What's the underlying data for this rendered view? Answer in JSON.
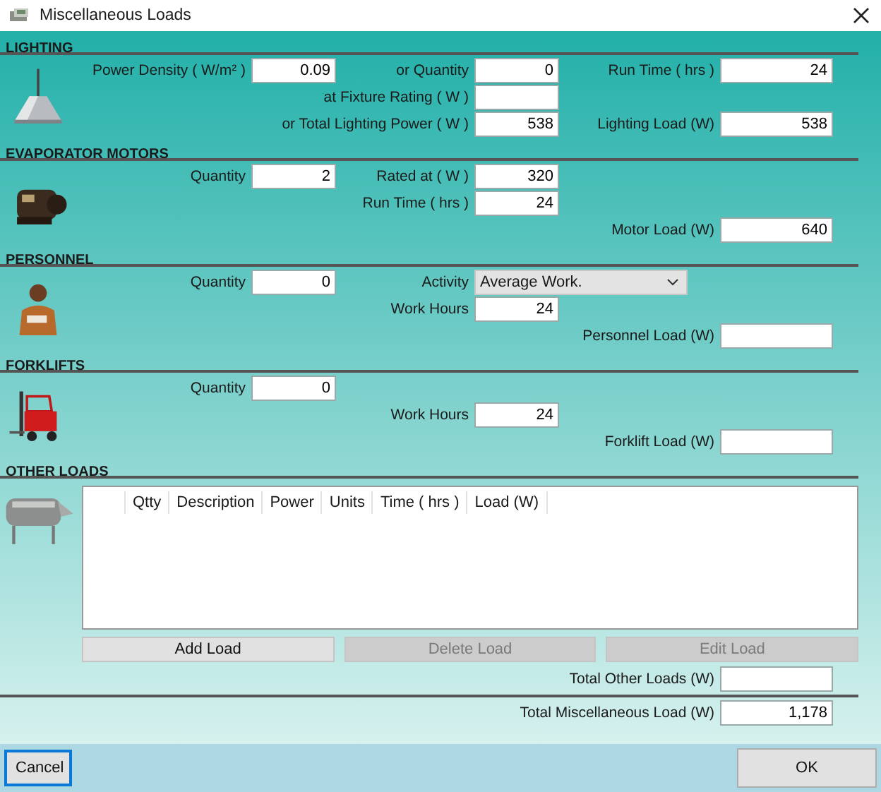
{
  "window": {
    "title": "Miscellaneous Loads"
  },
  "sections": [
    {
      "title": "LIGHTING",
      "rows": [
        {
          "left": {
            "label": "Power Density ( W/m² )",
            "value": "0.09"
          },
          "middle": {
            "label": "or Quantity",
            "value": "0"
          },
          "right": {
            "label": "Run Time ( hrs )",
            "value": "24"
          }
        },
        {
          "middle": {
            "label": "at Fixture Rating ( W )"
          }
        },
        {
          "middle": {
            "label": "or Total Lighting Power ( W )",
            "value": "538"
          },
          "right": {
            "label": "Lighting Load (W)",
            "value": "538"
          }
        }
      ]
    },
    {
      "title": "EVAPORATOR MOTORS",
      "rows": [
        {
          "left": {
            "label": "Quantity",
            "value": "2"
          },
          "middle": {
            "label": "Rated at ( W )",
            "value": "320"
          }
        },
        {
          "middle": {
            "label": "Run Time ( hrs )",
            "value": "24"
          }
        },
        {
          "right": {
            "label": "Motor Load (W)",
            "value": "640"
          }
        }
      ]
    },
    {
      "title": "PERSONNEL",
      "rows": [
        {
          "left": {
            "label": "Quantity",
            "value": "0"
          },
          "middle": {
            "label": "Activity",
            "kind": "dropdown",
            "value": "Average Work."
          }
        },
        {
          "middle": {
            "label": "Work Hours",
            "value": "24"
          }
        },
        {
          "right": {
            "label": "Personnel Load (W)"
          }
        }
      ]
    },
    {
      "title": "FORKLIFTS",
      "rows": [
        {
          "left": {
            "label": "Quantity",
            "value": "0"
          }
        },
        {
          "middle": {
            "label": "Work Hours",
            "value": "24"
          }
        },
        {
          "right": {
            "label": "Forklift Load (W)"
          }
        }
      ]
    }
  ],
  "other_loads": {
    "title": "OTHER LOADS",
    "columns": [
      "Qtty",
      "Description",
      "Power",
      "Units",
      "Time ( hrs )",
      "Load (W)"
    ],
    "buttons": [
      {
        "label": "Add Load",
        "disabled": false
      },
      {
        "label": "Delete Load",
        "disabled": true
      },
      {
        "label": "Edit Load",
        "disabled": true
      }
    ],
    "total_other": {
      "label": "Total Other Loads (W)"
    },
    "total_misc": {
      "label": "Total Miscellaneous Load (W)",
      "value": "1,178"
    }
  },
  "footer": [
    {
      "label": "Cancel",
      "focused": true
    },
    {
      "label": "OK",
      "focused": false
    }
  ]
}
